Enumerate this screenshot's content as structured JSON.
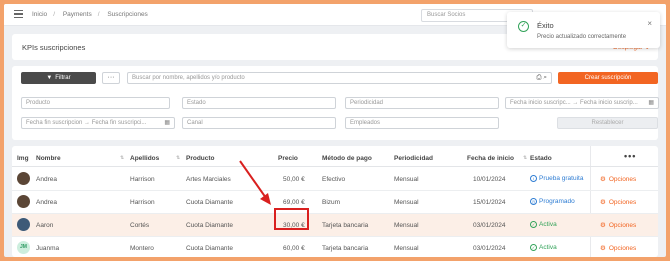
{
  "breadcrumb": [
    "Inicio",
    "Payments",
    "Suscripciones"
  ],
  "header": {
    "search_placeholder": "Buscar Socios"
  },
  "kpi": {
    "title": "KPIs suscripciones",
    "toggle_label": "Desplegar"
  },
  "toolbar": {
    "filter_label": "Filtrar",
    "more_label": "···",
    "search_placeholder": "Buscar por nombre, apellidos y/o producto",
    "add_label": "Crear suscripción"
  },
  "filters": {
    "producto": "Producto",
    "estado": "Estado",
    "periodicidad": "Periodicidad",
    "fecha_inicio_desde": "Fecha inicio suscripc...",
    "fecha_inicio_hasta": "Fecha inicio suscrip...",
    "fecha_fin_desde": "Fecha fin suscripcion",
    "fecha_fin_hasta": "Fecha fin suscripci...",
    "canal": "Canal",
    "empleados": "Empleados",
    "reset_label": "Restablecer"
  },
  "table": {
    "columns": [
      "Img",
      "Nombre",
      "Apellidos",
      "Producto",
      "Precio",
      "Método de pago",
      "Periodicidad",
      "Fecha de inicio",
      "Estado"
    ],
    "options_header": "•••",
    "rows": [
      {
        "avatar": "photo",
        "nombre": "Andrea",
        "apellidos": "Harrison",
        "producto": "Artes Marciales",
        "precio": "50,00 €",
        "metodo": "Efectivo",
        "periodicidad": "Mensual",
        "fecha": "10/01/2024",
        "estado": "Prueba gratuita",
        "estado_color": "#2f7dd3",
        "opciones": "Opciones"
      },
      {
        "avatar": "photo",
        "nombre": "Andrea",
        "apellidos": "Harrison",
        "producto": "Cuota Diamante",
        "precio": "69,00 €",
        "metodo": "Bizum",
        "periodicidad": "Mensual",
        "fecha": "15/01/2024",
        "estado": "Programado",
        "estado_color": "#2f7dd3",
        "opciones": "Opciones"
      },
      {
        "avatar": "photo",
        "nombre": "Aaron",
        "apellidos": "Cortés",
        "producto": "Cuota Diamante",
        "precio": "30,00 €",
        "metodo": "Tarjeta bancaria",
        "periodicidad": "Mensual",
        "fecha": "03/01/2024",
        "estado": "Activa",
        "estado_color": "#33a35a",
        "opciones": "Opciones"
      },
      {
        "avatar": "JM",
        "nombre": "Juanma",
        "apellidos": "Montero",
        "producto": "Cuota Diamante",
        "precio": "60,00 €",
        "metodo": "Tarjeta bancaria",
        "periodicidad": "Mensual",
        "fecha": "03/01/2024",
        "estado": "Activa",
        "estado_color": "#33a35a",
        "opciones": "Opciones"
      }
    ]
  },
  "toast": {
    "title": "Éxito",
    "message": "Precio actualizado correctamente",
    "close": "×"
  },
  "colors": {
    "accent": "#f26522",
    "success": "#33a35a",
    "info": "#2f7dd3",
    "annotation": "#d9201f"
  }
}
